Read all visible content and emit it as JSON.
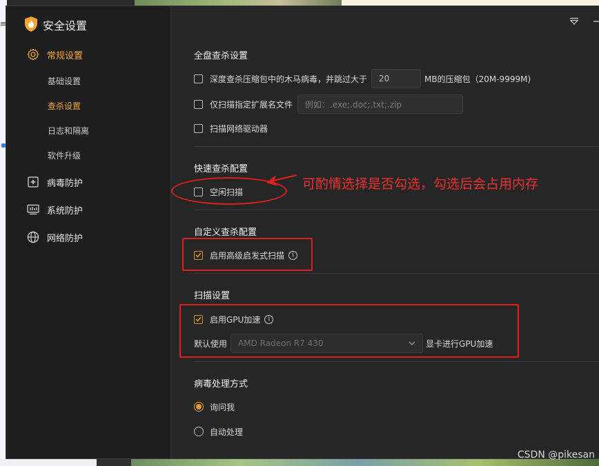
{
  "window": {
    "title": "安全设置"
  },
  "sidebar": {
    "items": [
      {
        "label": "常规设置",
        "icon": "gear-icon",
        "active": true,
        "children": [
          {
            "label": "基础设置",
            "active": false
          },
          {
            "label": "查杀设置",
            "active": true
          },
          {
            "label": "日志和隔离",
            "active": false
          },
          {
            "label": "软件升级",
            "active": false
          }
        ]
      },
      {
        "label": "病毒防护",
        "icon": "plus-square-icon",
        "active": false
      },
      {
        "label": "系统防护",
        "icon": "system-monitor-icon",
        "active": false
      },
      {
        "label": "网络防护",
        "icon": "globe-icon",
        "active": false
      }
    ]
  },
  "full_scan": {
    "title": "全盘查杀设置",
    "compressed": {
      "label_before": "深度查杀压缩包中的木马病毒，并跳过大于",
      "value": "20",
      "label_after": "MB的压缩包（20M-9999M)",
      "checked": false
    },
    "ext_only": {
      "label": "仅扫描指定扩展名文件",
      "placeholder": "例如：.exe;.doc;.txt;.zip",
      "checked": false
    },
    "net_drive": {
      "label": "扫描网络驱动器",
      "checked": false
    }
  },
  "quick_scan": {
    "title": "快速查杀配置",
    "idle_scan": {
      "label": "空闲扫描",
      "checked": false
    }
  },
  "custom_scan": {
    "title": "自定义查杀配置",
    "heuristic": {
      "label": "启用高级启发式扫描",
      "checked": true
    }
  },
  "scan_settings": {
    "title": "扫描设置",
    "gpu": {
      "label": "启用GPU加速",
      "checked": true
    },
    "default_use_label": "默认使用",
    "gpu_select_value": "AMD Radeon R7 430",
    "gpu_suffix": "显卡进行GPU加速"
  },
  "virus_handling": {
    "title": "病毒处理方式",
    "options": [
      {
        "label": "询问我",
        "selected": true
      },
      {
        "label": "自动处理",
        "selected": false
      }
    ]
  },
  "annotation": {
    "text": "可酌情选择是否勾选，勾选后会占用内存",
    "color": "#f03030"
  },
  "watermark": "CSDN @pikesan",
  "colors": {
    "accent": "#f0a53a",
    "annotation_red": "#e02020",
    "panel_bg": "#262626",
    "sidebar_bg": "#1e1e1e"
  }
}
